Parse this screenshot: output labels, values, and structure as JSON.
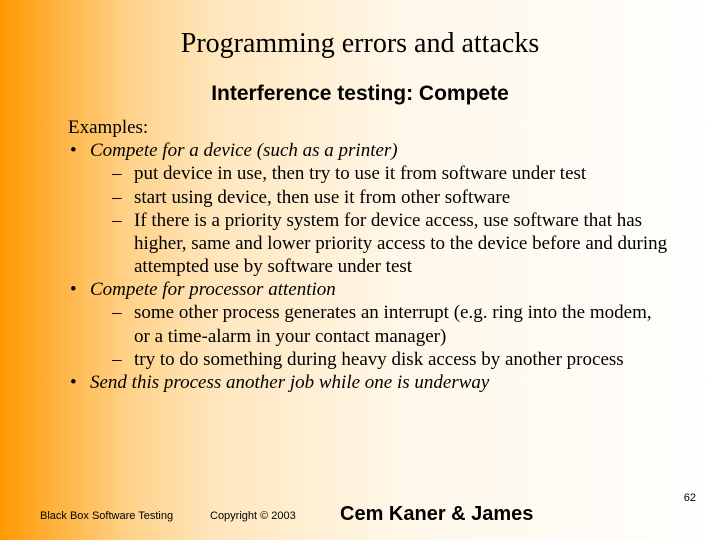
{
  "title": "Programming errors and attacks",
  "subtitle": "Interference testing: Compete",
  "examples_label": "Examples:",
  "bullets": [
    {
      "text": "Compete for a device (such as a printer)",
      "sub": [
        "put device in use, then try to use it from software under test",
        "start using device, then use it from other software",
        "If there is a priority system for device access, use software that has higher, same and lower priority access to the device before and during attempted use by software under test"
      ]
    },
    {
      "text": "Compete for processor attention",
      "sub": [
        "some other process generates an interrupt (e.g. ring into the modem, or a time-alarm in your contact manager)",
        "try to do something during heavy disk access by another process"
      ]
    },
    {
      "text": "Send this process another job while one is underway",
      "sub": []
    }
  ],
  "footer": {
    "left": "Black Box Software Testing",
    "copyright": "Copyright ©  2003",
    "authors": "Cem Kaner & James",
    "page": "62"
  }
}
